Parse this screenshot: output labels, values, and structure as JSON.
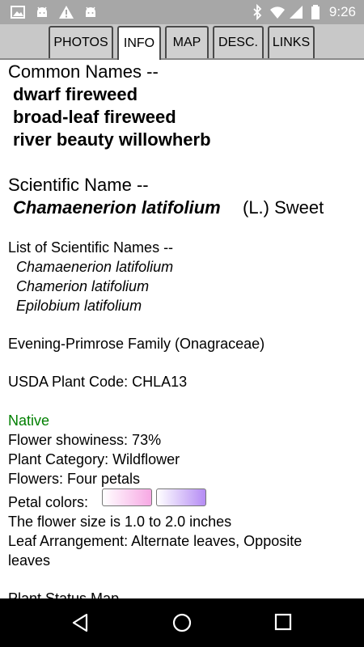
{
  "status_bar": {
    "time": "9:26"
  },
  "tabs": [
    {
      "label": "PHOTOS"
    },
    {
      "label": "INFO"
    },
    {
      "label": "MAP"
    },
    {
      "label": "DESC."
    },
    {
      "label": "LINKS"
    }
  ],
  "info": {
    "common_heading": "Common Names --",
    "common_names": [
      "dwarf fireweed",
      "broad-leaf fireweed",
      "river beauty willowherb"
    ],
    "scientific_heading": "Scientific Name --",
    "scientific_name": "Chamaenerion latifolium",
    "authority": "(L.) Sweet",
    "list_heading": "List of Scientific Names --",
    "scientific_names": [
      "Chamaenerion latifolium",
      "Chamerion latifolium",
      "Epilobium latifolium"
    ],
    "family": "Evening-Primrose Family (Onagraceae)",
    "usda_code": "USDA Plant Code: CHLA13",
    "native": "Native",
    "showiness": "Flower showiness: 73%",
    "category": "Plant Category: Wildflower",
    "flowers": "Flowers: Four petals",
    "petal_label": "Petal colors:",
    "petal_colors": [
      "#f7a8e4",
      "#b58cf4"
    ],
    "flower_size": "The flower size is 1.0 to 2.0 inches",
    "leaf_arrangement_1": "Leaf Arrangement: Alternate leaves, Opposite",
    "leaf_arrangement_2": "leaves",
    "status_map": "Plant Status Map"
  }
}
